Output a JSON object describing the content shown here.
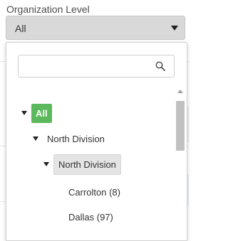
{
  "field": {
    "label": "Organization Level",
    "selected_value": "All"
  },
  "search": {
    "placeholder": "",
    "value": ""
  },
  "tree": {
    "all": "All",
    "division_parent": "North Division",
    "division_child": "North Division",
    "items": [
      "Carrolton (8)",
      "Dallas (97)"
    ]
  },
  "colors": {
    "all_badge": "#5cb85c",
    "selected_bg": "#e4e4e4",
    "select_bg": "#d9d9d9"
  }
}
